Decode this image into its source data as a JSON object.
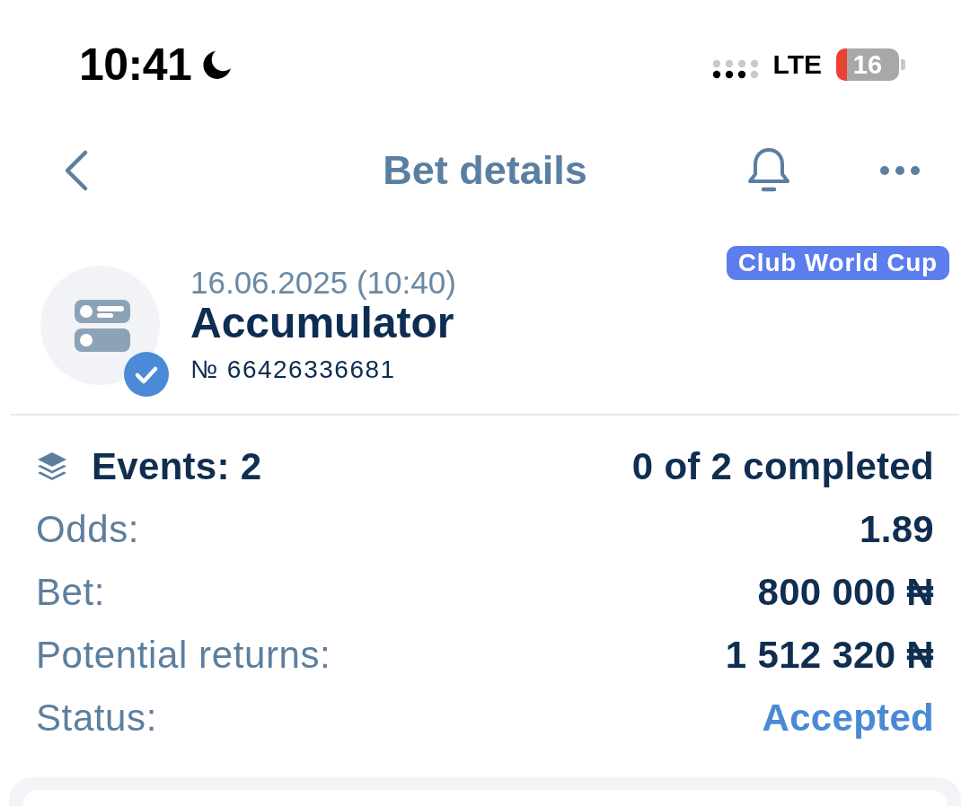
{
  "status_bar": {
    "time": "10:41",
    "network": "LTE",
    "battery": "16"
  },
  "nav": {
    "title": "Bet details"
  },
  "bet": {
    "date": "16.06.2025 (10:40)",
    "type": "Accumulator",
    "number": "№ 66426336681",
    "tag": "Club World Cup",
    "verified": true
  },
  "details": [
    {
      "kind": "events",
      "label": "Events: 2",
      "value": "0 of 2 completed"
    },
    {
      "kind": "plain",
      "label": "Odds:",
      "value": "1.89"
    },
    {
      "kind": "plain",
      "label": "Bet:",
      "value": "800 000 ₦"
    },
    {
      "kind": "plain",
      "label": "Potential returns:",
      "value": "1 512 320 ₦"
    },
    {
      "kind": "status",
      "label": "Status:",
      "value": "Accepted"
    }
  ]
}
